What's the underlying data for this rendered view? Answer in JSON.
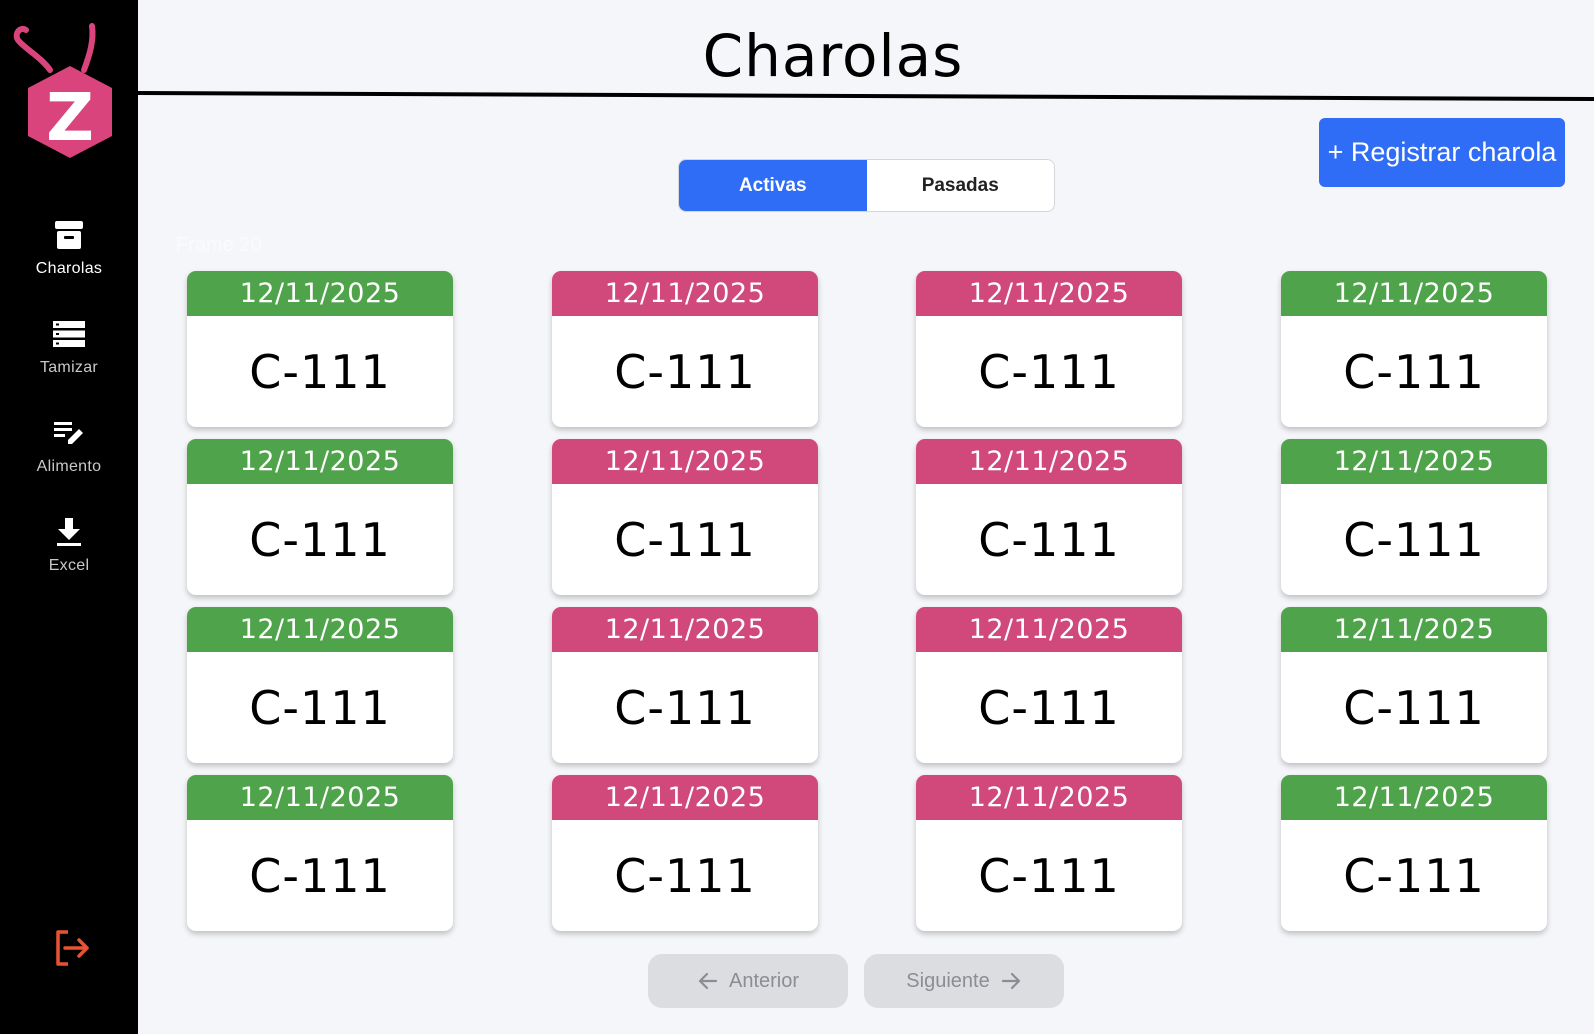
{
  "app": {
    "logo_letter": "Z",
    "title": "Charolas",
    "frame_label": "Frame 20"
  },
  "sidebar": {
    "items": [
      {
        "label": "Charolas",
        "icon": "archive-box-icon",
        "active": true
      },
      {
        "label": "Tamizar",
        "icon": "stacked-layers-icon",
        "active": false
      },
      {
        "label": "Alimento",
        "icon": "edit-list-icon",
        "active": false
      },
      {
        "label": "Excel",
        "icon": "download-icon",
        "active": false
      }
    ],
    "logout_icon": "logout-icon"
  },
  "toolbar": {
    "register_label": "+ Registrar charola"
  },
  "tabs": [
    {
      "label": "Activas",
      "active": true
    },
    {
      "label": "Pasadas",
      "active": false
    }
  ],
  "colors": {
    "accent": "#2f6df6",
    "green": "#4fa34a",
    "pink": "#d1487b",
    "logo_pink": "#d9447c",
    "logout_red": "#e85433"
  },
  "cards": [
    {
      "date": "12/11/2025",
      "code": "C-111",
      "status": "green"
    },
    {
      "date": "12/11/2025",
      "code": "C-111",
      "status": "pink"
    },
    {
      "date": "12/11/2025",
      "code": "C-111",
      "status": "pink"
    },
    {
      "date": "12/11/2025",
      "code": "C-111",
      "status": "green"
    },
    {
      "date": "12/11/2025",
      "code": "C-111",
      "status": "green"
    },
    {
      "date": "12/11/2025",
      "code": "C-111",
      "status": "pink"
    },
    {
      "date": "12/11/2025",
      "code": "C-111",
      "status": "pink"
    },
    {
      "date": "12/11/2025",
      "code": "C-111",
      "status": "green"
    },
    {
      "date": "12/11/2025",
      "code": "C-111",
      "status": "green"
    },
    {
      "date": "12/11/2025",
      "code": "C-111",
      "status": "pink"
    },
    {
      "date": "12/11/2025",
      "code": "C-111",
      "status": "pink"
    },
    {
      "date": "12/11/2025",
      "code": "C-111",
      "status": "green"
    },
    {
      "date": "12/11/2025",
      "code": "C-111",
      "status": "green"
    },
    {
      "date": "12/11/2025",
      "code": "C-111",
      "status": "pink"
    },
    {
      "date": "12/11/2025",
      "code": "C-111",
      "status": "pink"
    },
    {
      "date": "12/11/2025",
      "code": "C-111",
      "status": "green"
    }
  ],
  "pagination": {
    "prev_label": "Anterior",
    "next_label": "Siguiente"
  }
}
